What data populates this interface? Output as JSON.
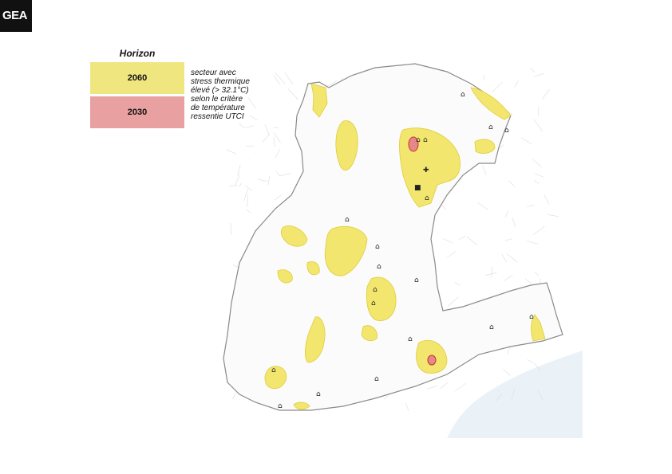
{
  "logo": {
    "text": "GEA"
  },
  "legend": {
    "title": "Horizon",
    "items": [
      {
        "label": "2060",
        "color": "#f0e680"
      },
      {
        "label": "2030",
        "color": "#e8a0a0"
      }
    ],
    "description": [
      "secteur avec",
      "stress thermique",
      "élevé (> 32.1°C)",
      "selon le critère",
      "de température",
      "ressentie UTCI"
    ]
  },
  "map": {
    "colors": {
      "zone_2060": "#f2e66e",
      "zone_2060_stroke": "#e0cc3a",
      "zone_2030": "#e8878a",
      "zone_2030_stroke": "#c0392b",
      "outline": "#8a8a8a",
      "streets": "#dcdcdc",
      "water": "#eaf2f8",
      "marker": "#222222"
    },
    "icons": [
      "school-icon",
      "hospital-cross-icon",
      "building-icon"
    ]
  }
}
